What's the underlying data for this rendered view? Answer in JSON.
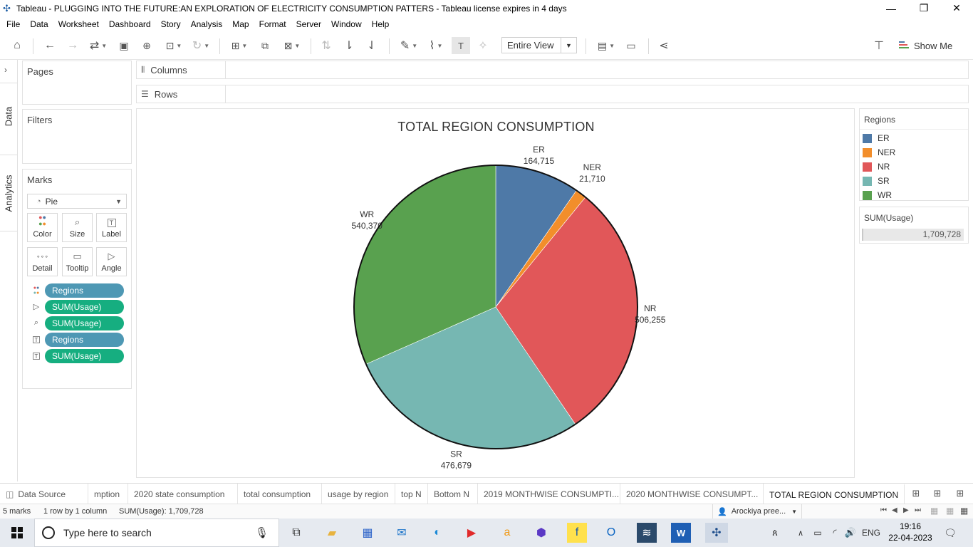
{
  "window": {
    "title": "Tableau - PLUGGING INTO THE FUTURE:AN EXPLORATION OF ELECTRICITY CONSUMPTION PATTERS - Tableau license expires in 4 days"
  },
  "menu": [
    "File",
    "Data",
    "Worksheet",
    "Dashboard",
    "Story",
    "Analysis",
    "Map",
    "Format",
    "Server",
    "Window",
    "Help"
  ],
  "toolbar": {
    "fit_value": "Entire View",
    "show_me_label": "Show Me"
  },
  "side_tabs": {
    "data": "Data",
    "analytics": "Analytics"
  },
  "cards": {
    "pages": "Pages",
    "filters": "Filters",
    "marks": "Marks",
    "columns": "Columns",
    "rows": "Rows"
  },
  "marks": {
    "type": "Pie",
    "buttons": [
      "Color",
      "Size",
      "Label",
      "Detail",
      "Tooltip",
      "Angle"
    ],
    "pills": [
      {
        "icon": "color-dots-icon",
        "label": "Regions",
        "kind": "dimension"
      },
      {
        "icon": "angle-icon",
        "label": "SUM(Usage)",
        "kind": "measure"
      },
      {
        "icon": "size-icon",
        "label": "SUM(Usage)",
        "kind": "measure"
      },
      {
        "icon": "text-icon",
        "label": "Regions",
        "kind": "dimension"
      },
      {
        "icon": "text-icon",
        "label": "SUM(Usage)",
        "kind": "measure"
      }
    ]
  },
  "chart_data": {
    "type": "pie",
    "title": "TOTAL REGION CONSUMPTION",
    "categories": [
      "ER",
      "NER",
      "NR",
      "SR",
      "WR"
    ],
    "values": [
      164715,
      21710,
      506255,
      476679,
      540370
    ],
    "labels": [
      "164,715",
      "21,710",
      "506,255",
      "476,679",
      "540,370"
    ],
    "colors": [
      "#4e79a7",
      "#f28e2b",
      "#e15759",
      "#76b7b2",
      "#59a14f"
    ],
    "legend_title": "Regions",
    "legend_placement": "right"
  },
  "sum_card": {
    "title": "SUM(Usage)",
    "value": "1,709,728"
  },
  "sheet_tabs": [
    "Data Source",
    "mption",
    "2020 state consumption",
    "total consumption",
    "usage by region",
    "top N",
    "Bottom N",
    "2019 MONTHWISE CONSUMPTI...",
    "2020 MONTHWISE CONSUMPT...",
    "TOTAL REGION CONSUMPTION"
  ],
  "status": {
    "marks": "5 marks",
    "dims": "1 row by 1 column",
    "sum": "SUM(Usage): 1,709,728",
    "user": "Arockiya pree..."
  },
  "taskbar": {
    "search_placeholder": "Type here to search",
    "lang": "ENG",
    "time": "19:16",
    "date": "22-04-2023"
  }
}
